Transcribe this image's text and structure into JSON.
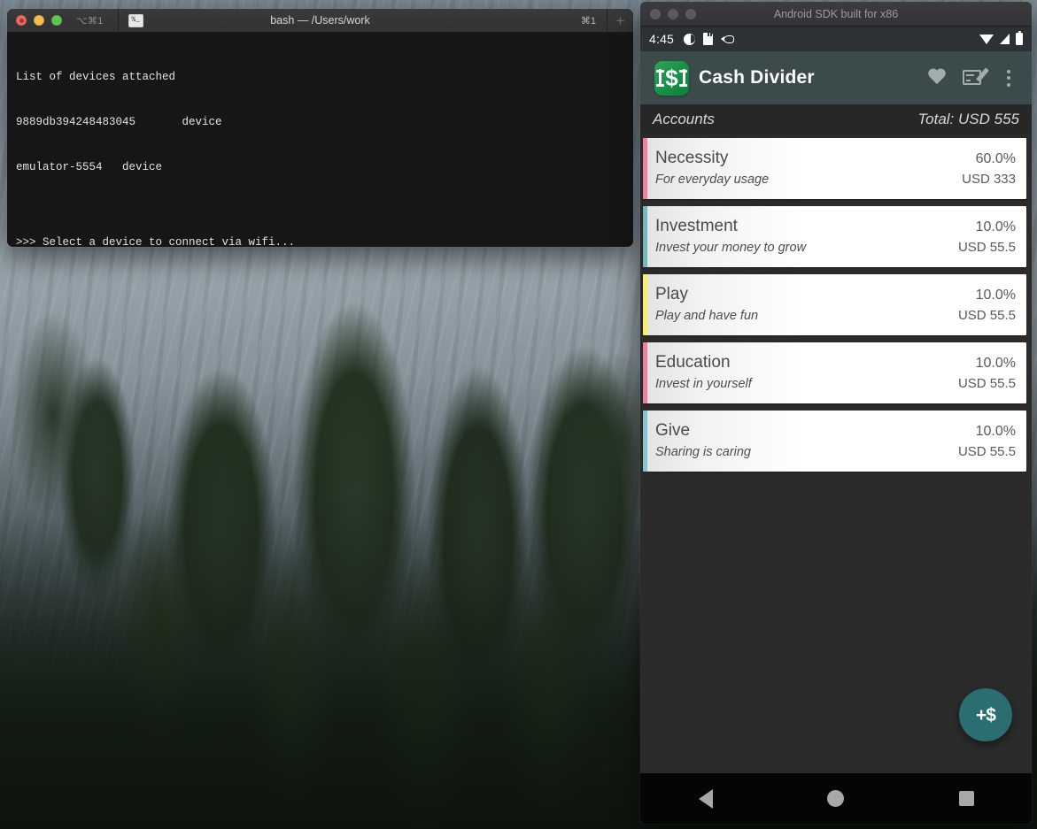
{
  "desktop": {
    "wallpaper_name": "yosemite-forest-wallpaper"
  },
  "terminal": {
    "title": "bash — /Users/work",
    "shortcut_left": "⌥⌘1",
    "shortcut_right": "⌘1",
    "tab_icon": "%_",
    "new_tab_label": "+",
    "lines": [
      "List of devices attached",
      "9889db394248483045       device",
      "emulator-5554   device",
      "",
      ">>> Select a device to connect via wifi..."
    ]
  },
  "emulator": {
    "window_title": "Android SDK built for x86",
    "statusbar": {
      "time": "4:45",
      "left_icons": [
        "half-circle-icon",
        "sd-card-icon",
        "fish-icon"
      ],
      "right_icons": [
        "wifi-icon",
        "signal-icon",
        "battery-icon"
      ]
    },
    "toolbar": {
      "app_icon": "cash-divider-app-icon",
      "dollar_glyph": "$",
      "title": "Cash Divider",
      "actions": [
        "heart-icon",
        "edit-signature-icon",
        "overflow-menu-icon"
      ]
    },
    "accounts_header": {
      "label": "Accounts",
      "total": "Total: USD 555"
    },
    "accounts": [
      {
        "name": "Necessity",
        "description": "For everyday usage",
        "percent": "60.0%",
        "amount": "USD 333",
        "color": "#f2809e"
      },
      {
        "name": "Investment",
        "description": "Invest your money to grow",
        "percent": "10.0%",
        "amount": "USD 55.5",
        "color": "#72b8bd"
      },
      {
        "name": "Play",
        "description": "Play and have fun",
        "percent": "10.0%",
        "amount": "USD 55.5",
        "color": "#f7ef6a"
      },
      {
        "name": "Education",
        "description": "Invest in yourself",
        "percent": "10.0%",
        "amount": "USD 55.5",
        "color": "#f0809f"
      },
      {
        "name": "Give",
        "description": "Sharing is caring",
        "percent": "10.0%",
        "amount": "USD 55.5",
        "color": "#86c4cf"
      }
    ],
    "fab": {
      "label": "+$",
      "color": "#2a6e72"
    },
    "navbar": {
      "buttons": [
        "back-icon",
        "home-icon",
        "recents-icon"
      ]
    }
  }
}
